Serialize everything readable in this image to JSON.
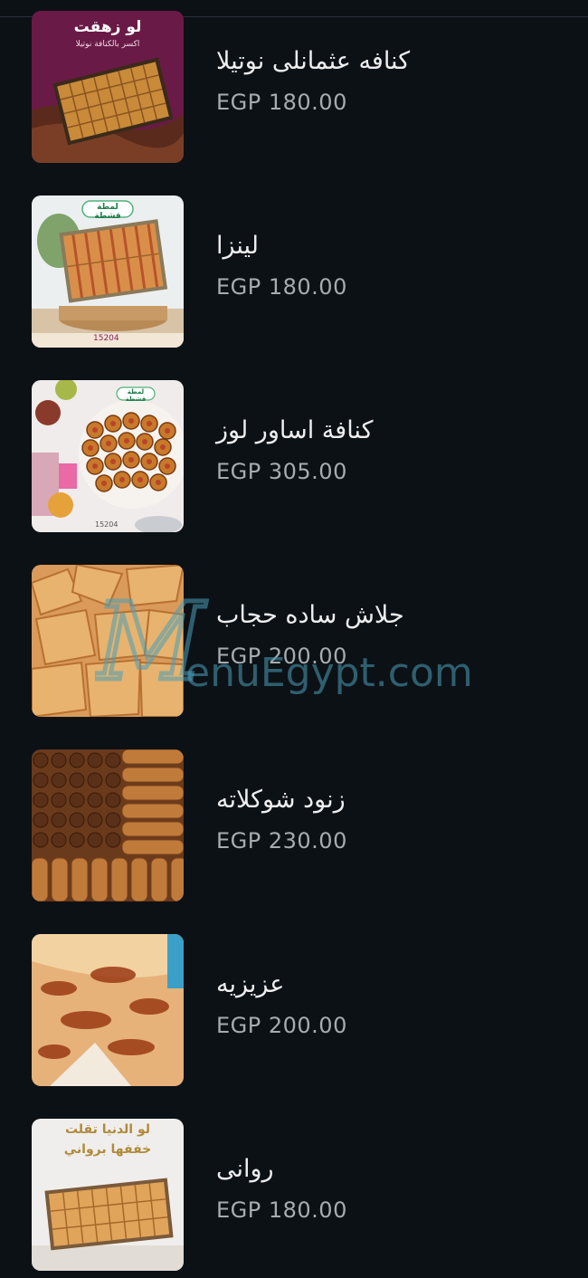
{
  "menu": {
    "items": [
      {
        "name": "كنافه عثمانلى نوتيلا",
        "price": "EGP 180.00",
        "image": "kunafa-nutella-tray-image",
        "image_text": [
          "لو زهقت",
          "اكسر بالكنافة نوتيلا"
        ]
      },
      {
        "name": "لينزا",
        "price": "EGP 180.00",
        "image": "linza-tray-image",
        "image_text": [
          "لمطة قشطة",
          "15204"
        ]
      },
      {
        "name": "كنافة اساور لوز",
        "price": "EGP 305.00",
        "image": "kunafa-bracelets-almond-image",
        "image_text": [
          "لمطة قشطة",
          "15204"
        ]
      },
      {
        "name": "جلاش ساده حجاب",
        "price": "EGP 200.00",
        "image": "plain-goulash-pastry-image",
        "image_text": []
      },
      {
        "name": "زنود شوكلاته",
        "price": "EGP 230.00",
        "image": "chocolate-znoud-image",
        "image_text": []
      },
      {
        "name": "عزيزيه",
        "price": "EGP 200.00",
        "image": "aziziya-image",
        "image_text": []
      },
      {
        "name": "روانى",
        "price": "EGP 180.00",
        "image": "rawani-tray-image",
        "image_text": [
          "لو الدنيا تقلت",
          "خففها برواني"
        ]
      }
    ]
  },
  "watermark": {
    "text": "MenuEgypt.com"
  },
  "colors": {
    "background": "#0c1116",
    "name_text": "#eeeeee",
    "price_text": "#a7acb1",
    "watermark": "#4a9fb8"
  }
}
